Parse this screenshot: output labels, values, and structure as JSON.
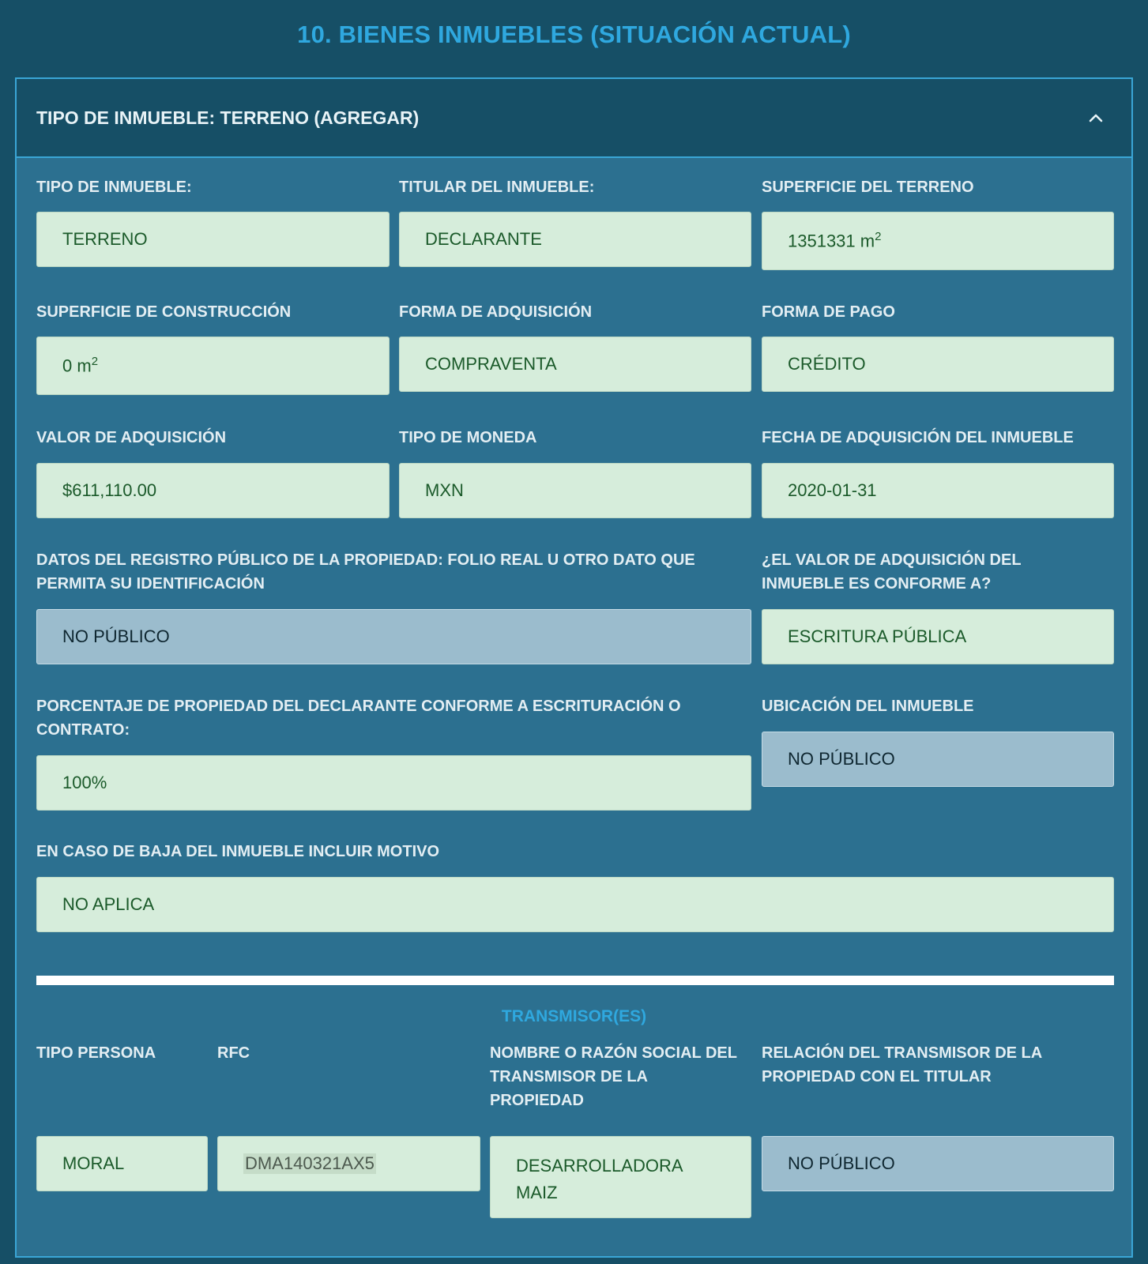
{
  "page": {
    "title": "10. BIENES INMUEBLES (SITUACIÓN ACTUAL)"
  },
  "panel": {
    "header": "TIPO DE INMUEBLE: TERRENO (AGREGAR)",
    "toggle_icon": "chevron-up-icon"
  },
  "fields": {
    "tipo_inmueble": {
      "label": "TIPO DE INMUEBLE:",
      "value": "TERRENO"
    },
    "titular": {
      "label": "TITULAR DEL INMUEBLE:",
      "value": "DECLARANTE"
    },
    "superficie_terreno": {
      "label": "SUPERFICIE DEL TERRENO",
      "value": "1351331 m",
      "unit_exp": "2"
    },
    "superficie_construccion": {
      "label": "SUPERFICIE DE CONSTRUCCIÓN",
      "value": "0 m",
      "unit_exp": "2"
    },
    "forma_adquisicion": {
      "label": "FORMA DE ADQUISICIÓN",
      "value": "COMPRAVENTA"
    },
    "forma_pago": {
      "label": "FORMA DE PAGO",
      "value": "CRÉDITO"
    },
    "valor_adquisicion": {
      "label": "VALOR DE ADQUISICIÓN",
      "value": "$611,110.00"
    },
    "tipo_moneda": {
      "label": "TIPO DE MONEDA",
      "value": "MXN"
    },
    "fecha_adquisicion": {
      "label": "FECHA DE ADQUISICIÓN DEL INMUEBLE",
      "value": "2020-01-31"
    },
    "registro_publico": {
      "label_line1": "DATOS DEL REGISTRO PÚBLICO DE LA PROPIEDAD: FOLIO REAL U OTRO DATO QUE",
      "label_line2": "PERMITA SU IDENTIFICACIÓN",
      "value": "NO PÚBLICO"
    },
    "valor_conforme": {
      "label_line1": "¿EL VALOR DE ADQUISICIÓN DEL",
      "label_line2": "INMUEBLE ES CONFORME A?",
      "value": "ESCRITURA PÚBLICA"
    },
    "porcentaje": {
      "label_line1": "PORCENTAJE DE PROPIEDAD DEL DECLARANTE CONFORME A ESCRITURACIÓN O",
      "label_line2": "CONTRATO:",
      "value": "100%"
    },
    "ubicacion": {
      "label": "UBICACIÓN DEL INMUEBLE",
      "value": "NO PÚBLICO"
    },
    "motivo_baja": {
      "label": "EN CASO DE BAJA DEL INMUEBLE INCLUIR MOTIVO",
      "value": "NO APLICA"
    }
  },
  "transmisores": {
    "title": "TRANSMISOR(ES)",
    "headers": {
      "tipo_persona": "TIPO PERSONA",
      "rfc": "RFC",
      "nombre_line1": "NOMBRE O RAZÓN SOCIAL DEL",
      "nombre_line2": "TRANSMISOR DE LA",
      "nombre_line3": "PROPIEDAD",
      "relacion_line1": "RELACIÓN DEL TRANSMISOR DE LA",
      "relacion_line2": "PROPIEDAD CON EL TITULAR"
    },
    "row": {
      "tipo_persona": "MORAL",
      "rfc": "DMA140321AX5",
      "nombre_line1": "DESARROLLADORA",
      "nombre_line2": "MAIZ",
      "relacion": "NO PÚBLICO"
    }
  },
  "colors": {
    "background": "#164f66",
    "panel": "#2c7090",
    "accent": "#2fa8df",
    "field_public": "#d6eddb",
    "field_private": "#9bbccd"
  }
}
